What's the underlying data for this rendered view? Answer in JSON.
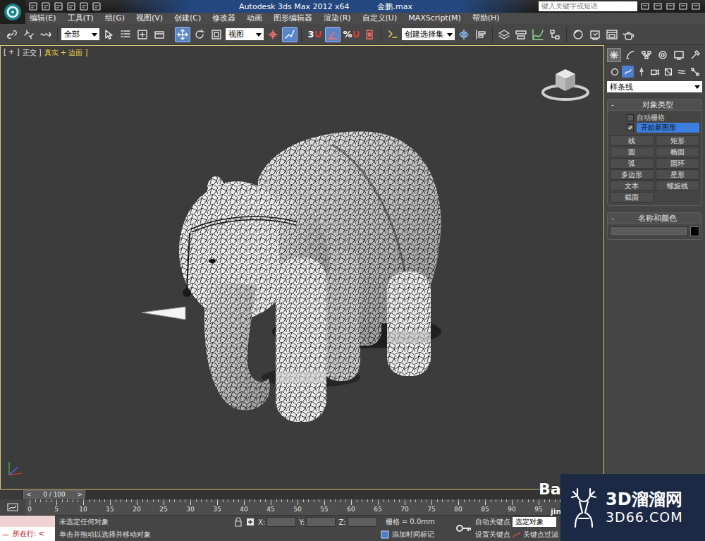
{
  "title_bar": {
    "title": "Autodesk 3ds Max  2012 x64",
    "file": "金鹏.max",
    "search_placeholder": "键入关键字或短语"
  },
  "menu": [
    "编辑(E)",
    "工具(T)",
    "组(G)",
    "视图(V)",
    "创建(C)",
    "修改器",
    "动画",
    "图形编辑器",
    "渲染(R)",
    "自定义(U)",
    "MAXScript(M)",
    "帮助(H)"
  ],
  "toolbar": [
    {
      "kind": "icon",
      "active": false
    },
    {
      "kind": "icon",
      "active": false
    },
    {
      "kind": "icon",
      "active": false
    },
    {
      "kind": "sep"
    },
    {
      "kind": "select",
      "value": "全部"
    },
    {
      "kind": "icon",
      "active": false
    },
    {
      "kind": "icon",
      "active": false
    },
    {
      "kind": "icon",
      "active": false
    },
    {
      "kind": "icon",
      "active": false
    },
    {
      "kind": "sep"
    },
    {
      "kind": "icon",
      "active": true
    },
    {
      "kind": "icon",
      "active": false
    },
    {
      "kind": "icon",
      "active": false
    },
    {
      "kind": "select",
      "value": "视图"
    },
    {
      "kind": "icon",
      "active": false
    },
    {
      "kind": "icon",
      "active": true
    },
    {
      "kind": "sep"
    },
    {
      "kind": "snap",
      "label": "3",
      "active": false
    },
    {
      "kind": "icon",
      "active": true
    },
    {
      "kind": "snap",
      "label": "%",
      "active": false
    },
    {
      "kind": "icon",
      "active": false
    },
    {
      "kind": "sep"
    },
    {
      "kind": "icon",
      "active": false
    },
    {
      "kind": "select",
      "value": "创建选择集"
    },
    {
      "kind": "icon",
      "active": false
    },
    {
      "kind": "icon",
      "active": false
    },
    {
      "kind": "sep"
    },
    {
      "kind": "icon",
      "active": false
    },
    {
      "kind": "icon",
      "active": false
    },
    {
      "kind": "icon",
      "active": false
    },
    {
      "kind": "icon",
      "active": false
    },
    {
      "kind": "sep"
    },
    {
      "kind": "icon",
      "active": false
    },
    {
      "kind": "icon",
      "active": false
    },
    {
      "kind": "icon",
      "active": false
    },
    {
      "kind": "icon",
      "active": false
    }
  ],
  "viewport": {
    "active": true,
    "labels": [
      {
        "text": "[ + ]",
        "highlighted": false
      },
      {
        "text": "正交 ]",
        "highlighted": false
      },
      {
        "text": "真实 + 边面 ]",
        "highlighted": true
      }
    ]
  },
  "command_panel": {
    "tabs": [
      {
        "selected": true
      },
      {
        "selected": false
      },
      {
        "selected": false
      },
      {
        "selected": false
      },
      {
        "selected": false
      },
      {
        "selected": false
      }
    ],
    "categories": [
      {
        "selected": false
      },
      {
        "selected": true
      },
      {
        "selected": false
      },
      {
        "selected": false
      },
      {
        "selected": false
      },
      {
        "selected": false
      },
      {
        "selected": false
      }
    ],
    "type": "样条线",
    "object_type": {
      "title": "对象类型",
      "collapse": "-",
      "checks": [
        {
          "label": "自动栅格",
          "checked": false,
          "highlighted": false
        },
        {
          "label": "开始新图形",
          "checked": true,
          "highlighted": true
        }
      ],
      "buttons": [
        "线",
        "矩形",
        "圆",
        "椭圆",
        "弧",
        "圆环",
        "多边形",
        "星形",
        "文本",
        "螺旋线",
        "截面"
      ]
    },
    "name_color": {
      "title": "名称和颜色",
      "collapse": "-",
      "name": "",
      "color": "#000000"
    }
  },
  "timeline": {
    "prev": "<",
    "position": "0 / 100",
    "next": ">",
    "level": 0,
    "ticks": [
      "0",
      "5",
      "10",
      "15",
      "20",
      "25",
      "30",
      "35",
      "40",
      "45",
      "50",
      "55",
      "60",
      "65",
      "70",
      "75",
      "80",
      "85",
      "90",
      "95"
    ]
  },
  "status_bar": {
    "listener_mark": "—",
    "listener_text": "所在行: <",
    "prompt": "未选定任何对象",
    "hint": "单击并拖动以选择并移动对象",
    "coords": [
      {
        "axis": "X:",
        "value": ""
      },
      {
        "axis": "Y:",
        "value": ""
      },
      {
        "axis": "Z:",
        "value": ""
      }
    ],
    "grid": "栅格 = 0.0mm",
    "time_tag": "添加时间标记",
    "auto_key": "自动关键点",
    "key_mode": "选定对象",
    "set_key": "设置关键点",
    "key_filters": "关键点过滤"
  },
  "watermarks": {
    "baidu_top": "Ba",
    "baidu_bottom": "jin",
    "brand": "3D溜溜网",
    "url": "3D66.COM"
  }
}
